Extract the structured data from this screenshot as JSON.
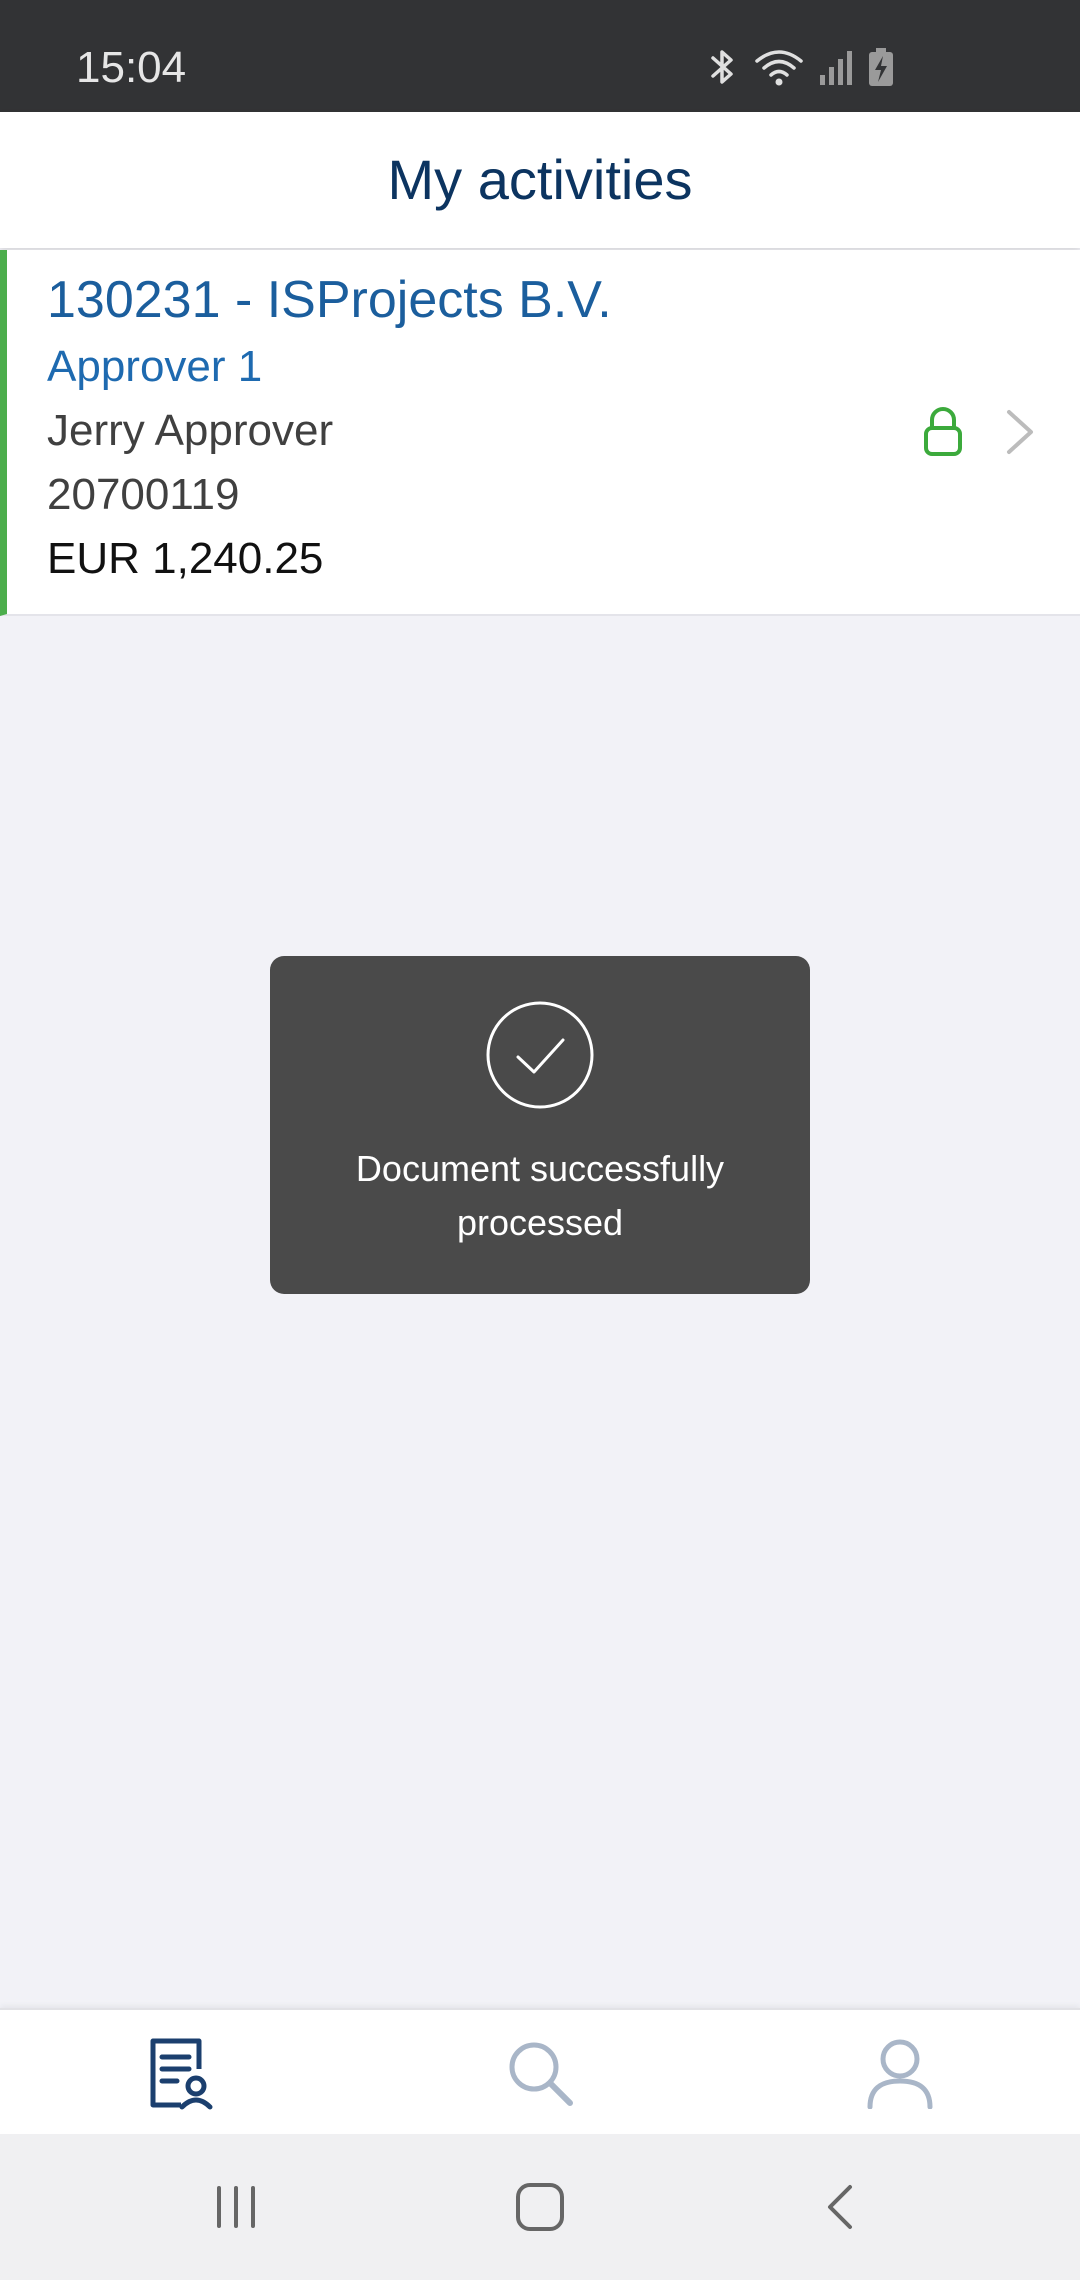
{
  "status_bar": {
    "time": "15:04",
    "icons": [
      "bluetooth-icon",
      "wifi-icon",
      "signal-icon",
      "battery-charging-icon"
    ]
  },
  "header": {
    "title": "My activities"
  },
  "activities": [
    {
      "title": "130231 - ISProjects B.V.",
      "role": "Approver 1",
      "person": "Jerry Approver",
      "document_number": "20700119",
      "amount": "EUR 1,240.25",
      "status_icon": "unlocked-lock-icon",
      "accent_color": "#4cae4c"
    }
  ],
  "toast": {
    "icon": "check-circle-icon",
    "message": "Document successfully processed"
  },
  "tab_bar": {
    "tabs": [
      {
        "name": "activities",
        "icon": "document-user-icon",
        "active": true
      },
      {
        "name": "search",
        "icon": "search-icon",
        "active": false
      },
      {
        "name": "profile",
        "icon": "user-icon",
        "active": false
      }
    ],
    "active_color": "#1b3f6e",
    "inactive_color": "#a9b6c8"
  },
  "system_nav": {
    "buttons": [
      "recent-apps-icon",
      "home-icon",
      "back-icon"
    ]
  }
}
